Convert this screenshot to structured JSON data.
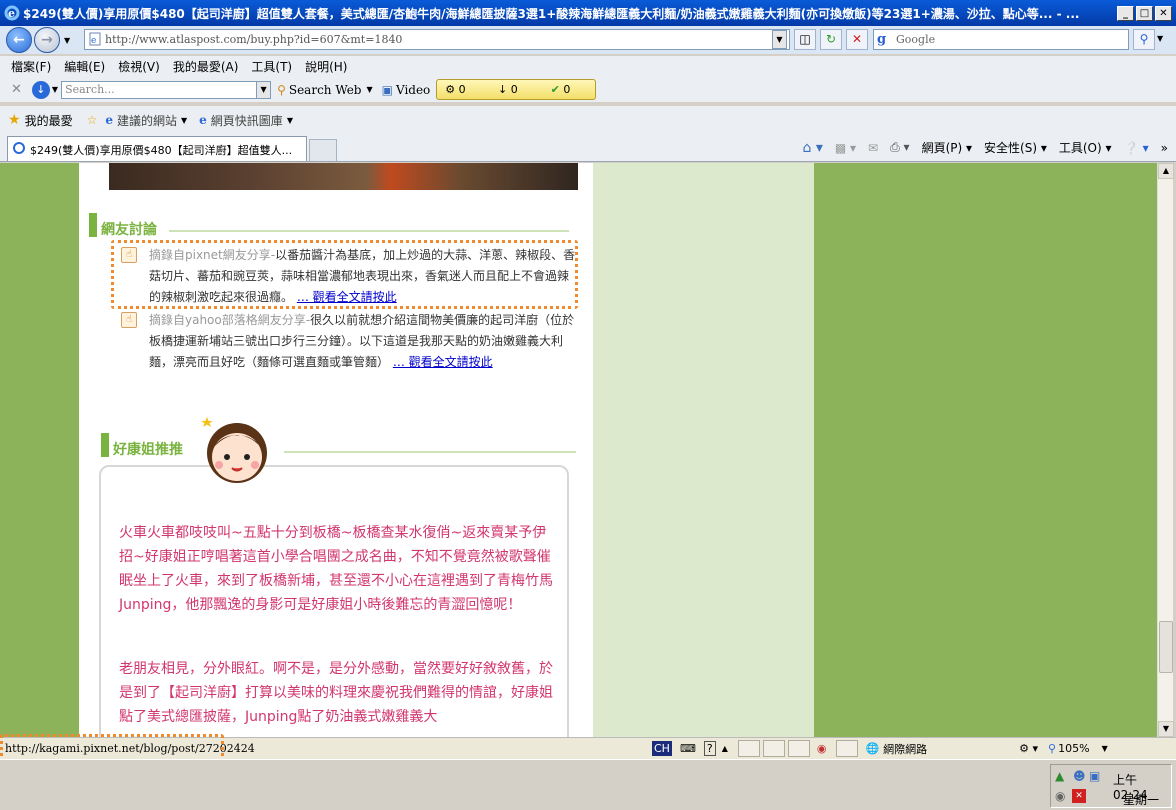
{
  "window": {
    "title": "$249(雙人價)享用原價$480【起司洋廚】超值雙人套餐，美式總匯/杏鮑牛肉/海鮮總匯披薩3選1+酸辣海鮮總匯義大利麵/奶油義式嫩雞義大利麵(亦可換燉飯)等23選1+濃湯、沙拉、點心等... - ...",
    "minimize": "_",
    "maximize": "□",
    "close": "✕"
  },
  "nav": {
    "address": "http://www.atlaspost.com/buy.php?id=607&mt=1840",
    "search_placeholder": "Google"
  },
  "menu": [
    "檔案(F)",
    "編輯(E)",
    "檢視(V)",
    "我的最愛(A)",
    "工具(T)",
    "說明(H)"
  ],
  "toolbar2": {
    "search_placeholder": "Search...",
    "search_web": "Search Web",
    "video": "Video",
    "counter1": "0",
    "counter2": "0",
    "counter3": "0"
  },
  "favorites": {
    "favorites_label": "我的最愛",
    "suggested_sites": "建議的網站",
    "web_slice": "網頁快訊圖庫"
  },
  "tab": {
    "label": "$249(雙人價)享用原價$480【起司洋廚】超值雙人..."
  },
  "commands": {
    "page": "網頁(P)",
    "safety": "安全性(S)",
    "tools": "工具(O)"
  },
  "page": {
    "discussion_title": "網友討論",
    "comment1_source": "摘錄自pixnet網友分享-",
    "comment1_text": "以番茄醬汁為基底，加上炒過的大蒜、洋蔥、辣椒段、香菇切片、蕃茄和豌豆莢，蒜味相當濃郁地表現出來，香氣迷人而且配上不會過辣的辣椒刺激吃起來很過癮。",
    "comment1_link": "… 觀看全文請按此",
    "comment2_source": "摘錄自yahoo部落格網友分享-",
    "comment2_text": "很久以前就想介紹這間物美價廉的起司洋廚（位於板橋捷運新埔站三號出口步行三分鐘）。以下這道是我那天點的奶油嫩雞義大利麵，漂亮而且好吃（麵條可選直麵或筆管麵）",
    "comment2_link": "… 觀看全文請按此",
    "recommend_title": "好康姐推推",
    "story1": "火車火車都吱吱叫~五點十分到板橋~板橋查某水復俏~返來賣某予伊招~好康姐正哼唱著這首小學合唱團之成名曲，不知不覺竟然被歌聲催眠坐上了火車，來到了板橋新埔，甚至還不小心在這裡遇到了青梅竹馬Junping，他那飄逸的身影可是好康姐小時後難忘的青澀回憶呢！",
    "story2": "老朋友相見，分外眼紅。啊不是，是分外感動，當然要好好敘敘舊，於是到了【起司洋廚】打算以美味的料理來慶祝我們難得的情誼，好康姐點了美式總匯披薩，Junping點了奶油義式嫩雞義大"
  },
  "status": {
    "url": "http://kagami.pixnet.net/blog/post/27202424",
    "ime": "CH",
    "zone": "網際網路",
    "zoom": "105%"
  },
  "clock": {
    "time": "上午 02:24",
    "day": "星期一"
  }
}
